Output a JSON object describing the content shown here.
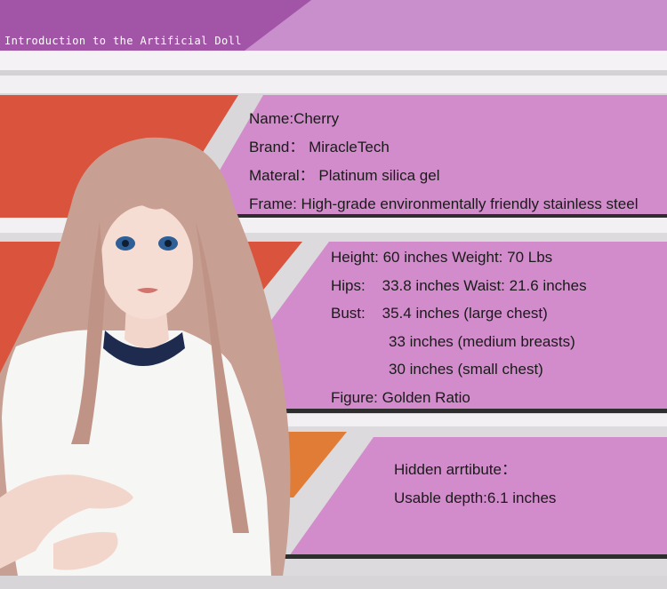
{
  "banner": {
    "title": "Introduction to the Artificial Doll"
  },
  "info_basic": {
    "name": "Name:Cherry",
    "brand": "Brand： MiracleTech",
    "material": "Materal： Platinum silica gel",
    "frame": "Frame: High-grade environmentally friendly stainless steel"
  },
  "info_body": {
    "height_weight": "Height: 60 inches Weight: 70 Lbs",
    "hips_waist": "Hips:    33.8 inches Waist: 21.6 inches",
    "bust": "Bust:    35.4 inches (large chest)",
    "bust_medium": "33 inches (medium breasts)",
    "bust_small": "30 inches (small chest)",
    "figure": "Figure: Golden Ratio"
  },
  "info_hidden": {
    "title": "Hidden arrtibute：",
    "depth": "Usable depth:6.1 inches"
  },
  "colors": {
    "banner_purple": "#c98fcc",
    "banner_dark": "#a255a6",
    "panel_pink": "#d28ccb",
    "panel_dark": "#2e2e2e",
    "accent_red": "#d9533d",
    "accent_orange": "#e07c35",
    "stripe_gray": "#cfcfcf"
  },
  "icons": [
    "doll-figure-illustration"
  ]
}
